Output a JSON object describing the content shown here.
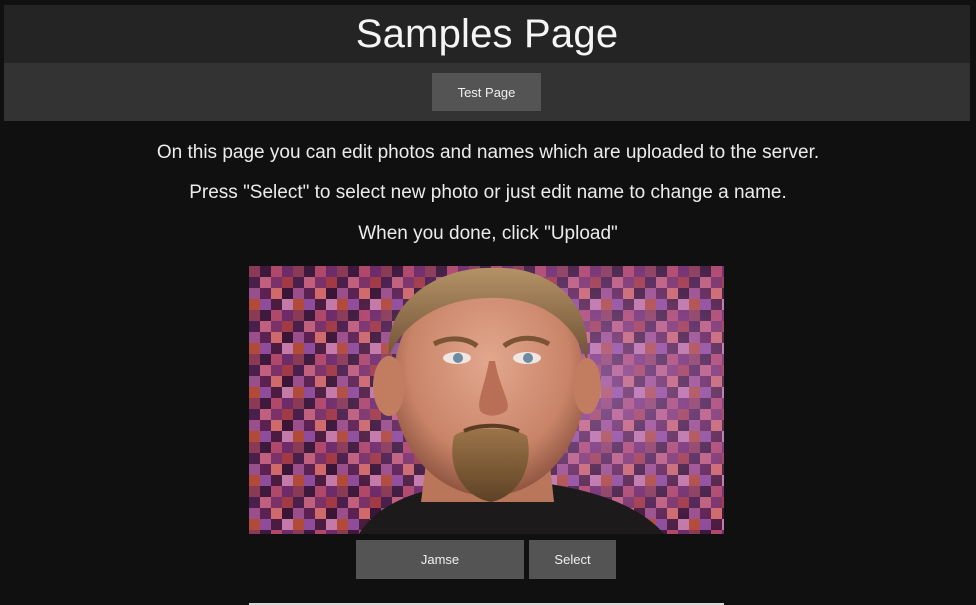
{
  "header": {
    "title": "Samples Page"
  },
  "nav": {
    "test_page_label": "Test Page"
  },
  "instructions": {
    "line1": "On this page you can edit photos and names which are uploaded to the server.",
    "line2": "Press \"Select\" to select new photo or just edit name to change a name.",
    "line3": "When you done, click \"Upload\""
  },
  "sample": {
    "photo_alt": "photo",
    "name_value": "Jamse",
    "select_label": "Select"
  },
  "colors": {
    "background": "#101010",
    "title_bar": "#242424",
    "nav_bar": "#333333",
    "button": "#545454",
    "text": "#ececec"
  }
}
